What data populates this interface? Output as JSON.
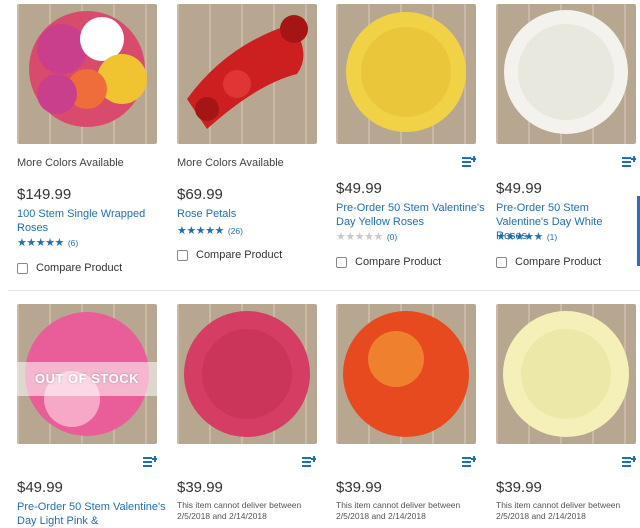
{
  "products": [
    {
      "more_colors": "More Colors Available",
      "price": "$149.99",
      "name": "100 Stem Single Wrapped Roses",
      "rating_stars": "★★★★★",
      "rating_count": "(6)",
      "compare_label": "Compare Product",
      "image_colors": [
        "#d94b6c",
        "#ffffff",
        "#f0c431",
        "#ef6d3a",
        "#c93f8b"
      ]
    },
    {
      "more_colors": "More Colors Available",
      "price": "$69.99",
      "name": "Rose Petals",
      "rating_stars": "★★★★★",
      "rating_count": "(26)",
      "compare_label": "Compare Product",
      "image_colors": [
        "#cc2020",
        "#a51515",
        "#e03535"
      ]
    },
    {
      "price": "$49.99",
      "name": "Pre-Order 50 Stem Valentine's Day Yellow Roses",
      "rating_stars": "★★★★★",
      "rating_count": "(0)",
      "compare_label": "Compare Product",
      "image_colors": [
        "#f1d246",
        "#d9b324"
      ]
    },
    {
      "price": "$49.99",
      "name": "Pre-Order 50 Stem Valentine's Day White Roses",
      "rating_stars": "★★★★★",
      "rating_count": "(1)",
      "compare_label": "Compare Product",
      "image_colors": [
        "#f3f2ec",
        "#dcdccf"
      ]
    },
    {
      "status_overlay": "OUT OF STOCK",
      "price": "$49.99",
      "name": "Pre-Order 50 Stem Valentine's Day Light Pink &",
      "image_colors": [
        "#e95e98",
        "#f7a8c7"
      ]
    },
    {
      "price": "$39.99",
      "note": "This item cannot deliver between 2/5/2018 and 2/14/2018",
      "image_colors": [
        "#d63d64",
        "#b62747"
      ]
    },
    {
      "price": "$39.99",
      "note": "This item cannot deliver between 2/5/2018 and 2/14/2018",
      "image_colors": [
        "#e84a1f",
        "#f3a537"
      ]
    },
    {
      "price": "$39.99",
      "note": "This item cannot deliver between 2/5/2018 and 2/14/2018",
      "image_colors": [
        "#f5f0b8",
        "#e2de92"
      ]
    }
  ],
  "colors": {
    "link": "#1f6fb5",
    "star_on": "#1f6fb5",
    "star_off": "#c8c8c8"
  },
  "icons": {
    "list": "list-add-icon"
  }
}
